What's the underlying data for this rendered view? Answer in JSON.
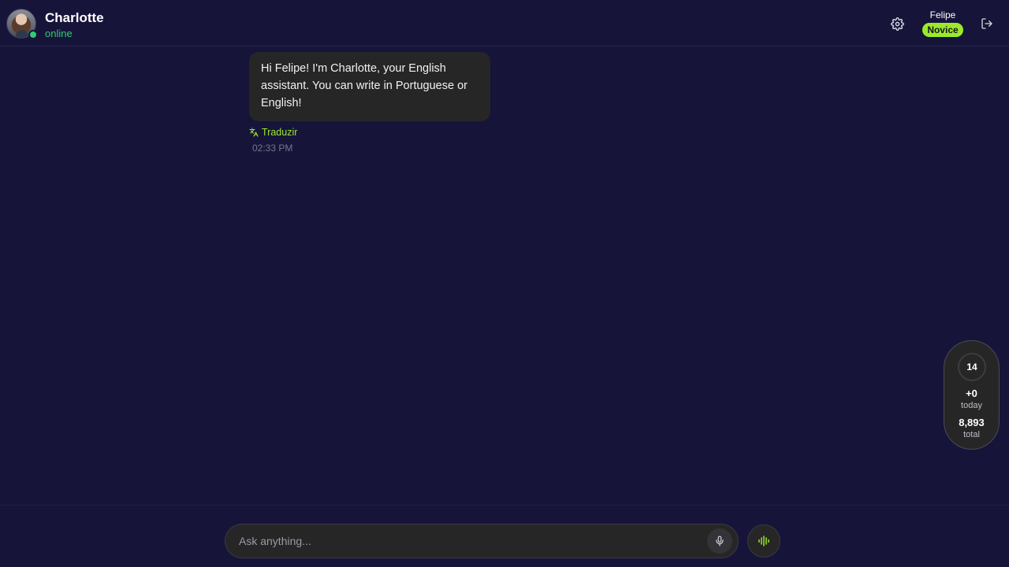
{
  "header": {
    "contact_name": "Charlotte",
    "contact_status": "online",
    "user_name": "Felipe",
    "user_level": "Novice",
    "accent_color": "#9bea2a",
    "status_color": "#2ecc71"
  },
  "messages": [
    {
      "sender": "Charlotte",
      "text": "Hi Felipe! I'm Charlotte, your English assistant. You can write in Portuguese or English!",
      "translate_label": "Traduzir",
      "time": "02:33 PM"
    }
  ],
  "xp": {
    "level": "14",
    "today_value": "+0",
    "today_label": "today",
    "total_value": "8,893",
    "total_label": "total"
  },
  "composer": {
    "placeholder": "Ask anything..."
  },
  "icons": {
    "settings": "gear-icon",
    "logout": "logout-icon",
    "translate": "translate-icon",
    "mic": "microphone-icon",
    "voice": "audio-wave-icon"
  }
}
